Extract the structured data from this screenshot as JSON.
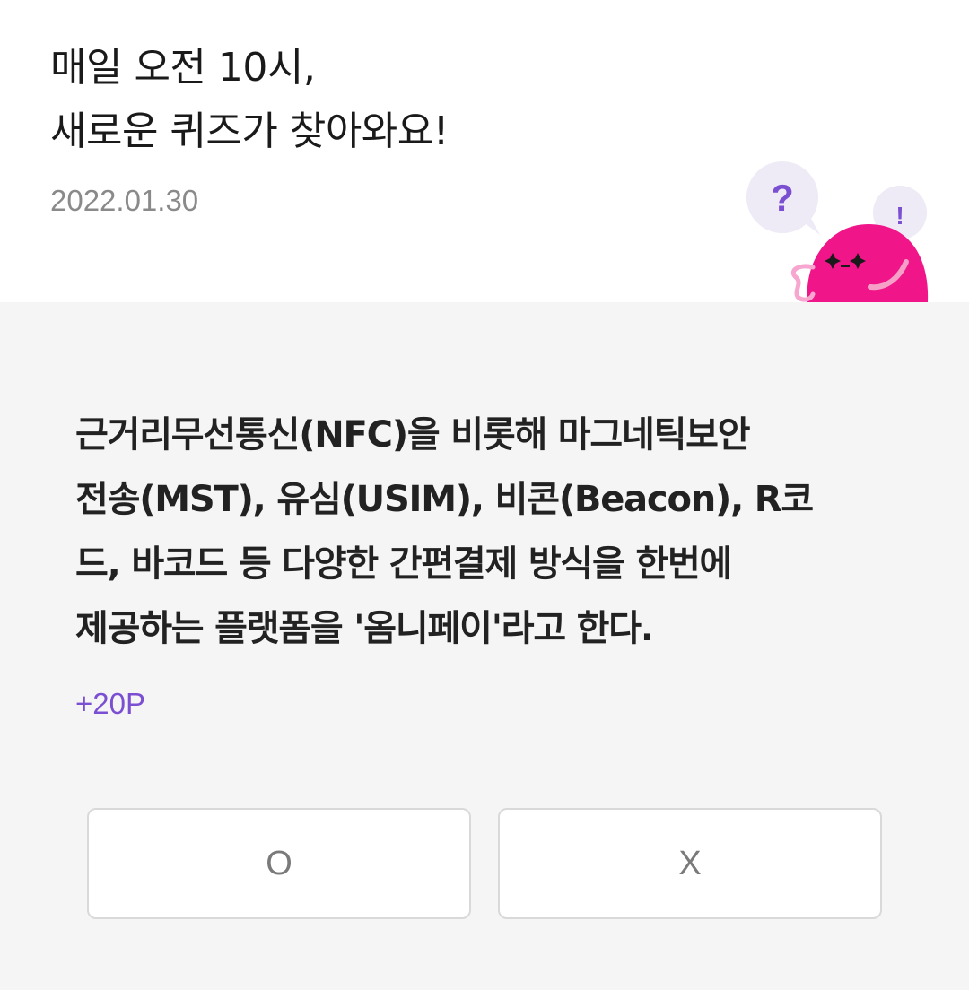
{
  "header": {
    "headline_line1": "매일 오전 10시,",
    "headline_line2": "새로운 퀴즈가 찾아와요!",
    "date": "2022.01.30"
  },
  "mascot": {
    "question_mark": "?",
    "exclamation_mark": "!",
    "icon": "pink-character-mascot-icon",
    "colors": {
      "body": "#f0168a",
      "bubble": "#eeeaf6",
      "accent": "#7b4fd1"
    }
  },
  "quiz": {
    "question_line1": "근거리무선통신(NFC)을 비롯해 마그네틱보안",
    "question_line2": "전송(MST), 유심(USIM), 비콘(Beacon), R코",
    "question_line3": "드, 바코드 등 다양한 간편결제 방식을 한번에",
    "question_line4": "제공하는 플랫폼을 '옴니페이'라고 한다.",
    "points": "+20P",
    "answer_o": "O",
    "answer_x": "X"
  }
}
